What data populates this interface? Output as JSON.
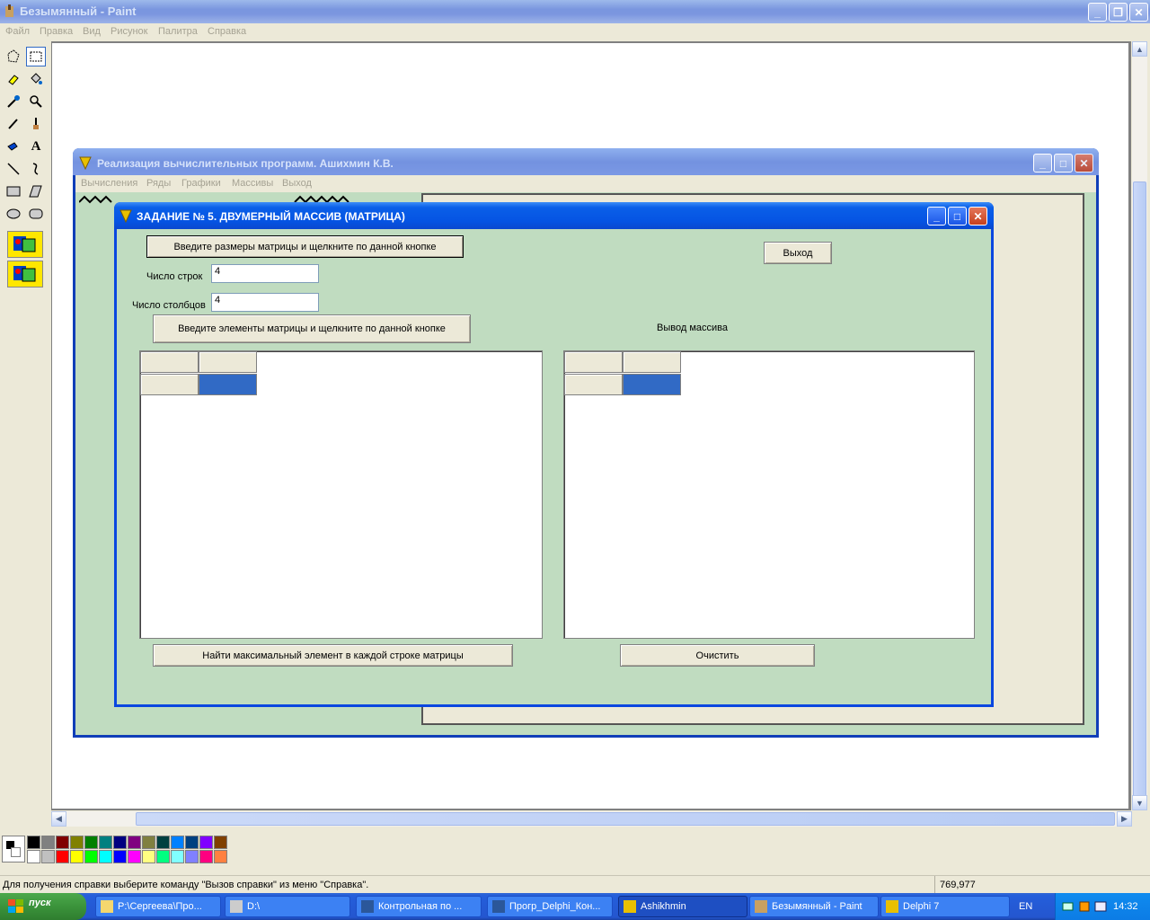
{
  "paint": {
    "title": "Безымянный - Paint",
    "menu": [
      "Файл",
      "Правка",
      "Вид",
      "Рисунок",
      "Палитра",
      "Справка"
    ],
    "status_text": "Для получения справки выберите команду \"Вызов справки\" из меню \"Справка\".",
    "coordinates": "769,977",
    "palette_colors": [
      "#000000",
      "#808080",
      "#800000",
      "#808000",
      "#008000",
      "#008080",
      "#000080",
      "#800080",
      "#808040",
      "#004040",
      "#0080ff",
      "#004080",
      "#8000ff",
      "#804000",
      "#ffffff",
      "#c0c0c0",
      "#ff0000",
      "#ffff00",
      "#00ff00",
      "#00ffff",
      "#0000ff",
      "#ff00ff",
      "#ffff80",
      "#00ff80",
      "#80ffff",
      "#8080ff",
      "#ff0080",
      "#ff8040"
    ]
  },
  "delphi_main": {
    "title": "Реализация вычислительных программ. Ашихмин К.В.",
    "menu": [
      "Вычисления",
      "Ряды",
      "Графики",
      "Массивы",
      "Выход"
    ]
  },
  "dialog": {
    "title": "ЗАДАНИЕ № 5. ДВУМЕРНЫЙ МАССИВ (МАТРИЦА)",
    "size_button": "Введите размеры матрицы и щелкните по данной кнопке",
    "exit_button": "Выход",
    "rows_label": "Число строк",
    "rows_value": "4",
    "cols_label": "Число столбцов",
    "cols_value": "4",
    "elements_button": "Введите элементы матрицы и щелкните по данной кнопке",
    "output_label": "Вывод массива",
    "find_max_button": "Найти максимальный элемент в каждой строке матрицы",
    "clear_button": "Очистить"
  },
  "taskbar": {
    "start": "пуск",
    "tasks": [
      {
        "label": "P:\\Сергеева\\Про...",
        "icon": "folder-icon"
      },
      {
        "label": "D:\\",
        "icon": "drive-icon"
      },
      {
        "label": "Контрольная по ...",
        "icon": "word-icon"
      },
      {
        "label": "Прогр_Delphi_Кон...",
        "icon": "word-icon"
      },
      {
        "label": "Ashikhmin",
        "icon": "delphi-icon"
      },
      {
        "label": "Безымянный - Paint",
        "icon": "paint-icon"
      },
      {
        "label": "Delphi 7",
        "icon": "delphi-icon"
      }
    ],
    "language": "EN",
    "clock": "14:32"
  }
}
